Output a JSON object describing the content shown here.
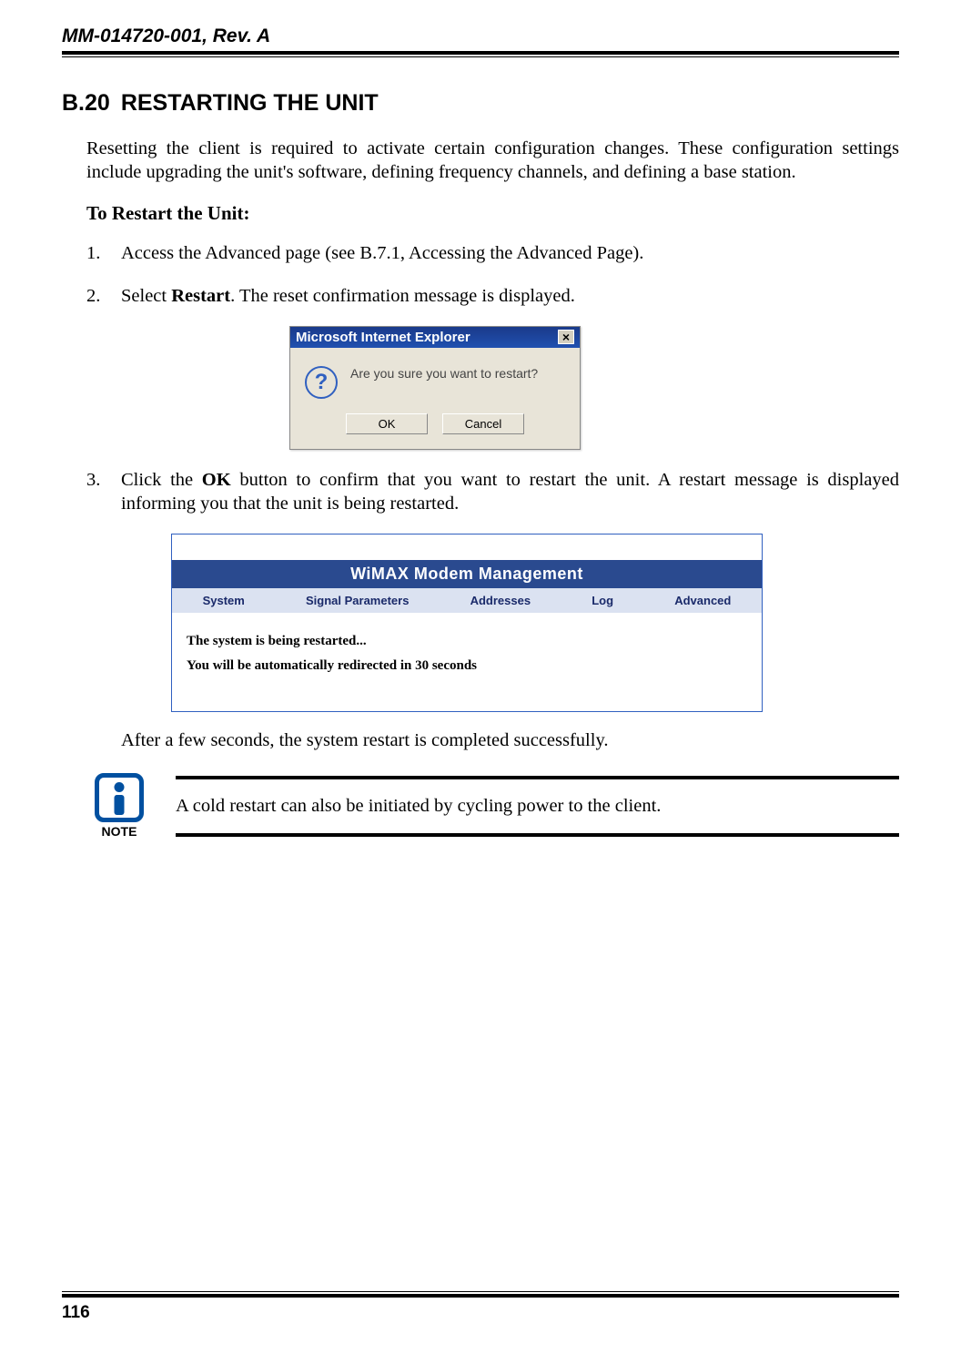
{
  "doc_id": "MM-014720-001, Rev. A",
  "section": {
    "number": "B.20",
    "title": "RESTARTING THE UNIT"
  },
  "intro": "Resetting the client is required to activate certain configuration changes.  These configuration settings include upgrading the unit's software, defining frequency channels, and defining a base station.",
  "subheading": "To Restart the Unit:",
  "step1_pre": "Access the Advanced page (see B.7.1, Accessing the Advanced Page).",
  "step2_pre": "Select ",
  "step2_bold": "Restart",
  "step2_post": ".  The reset confirmation message is displayed.",
  "dialog": {
    "title": "Microsoft Internet Explorer",
    "close": "×",
    "message": "Are you sure you want to restart?",
    "ok": "OK",
    "cancel": "Cancel"
  },
  "step3_pre": "Click the ",
  "step3_bold": "OK",
  "step3_post": " button to confirm that you want to restart the unit.  A restart message is displayed informing you that the unit is being restarted.",
  "mgmt": {
    "title": "WiMAX Modem Management",
    "nav": {
      "system": "System",
      "signal": "Signal Parameters",
      "addresses": "Addresses",
      "log": "Log",
      "advanced": "Advanced"
    },
    "line1": "The system is being restarted...",
    "line2": "You will be automatically redirected in 30 seconds"
  },
  "after": "After a few seconds, the system restart is completed successfully.",
  "note": {
    "label": "NOTE",
    "text": "A cold restart can also be initiated by cycling power to the client."
  },
  "page_number": "116"
}
